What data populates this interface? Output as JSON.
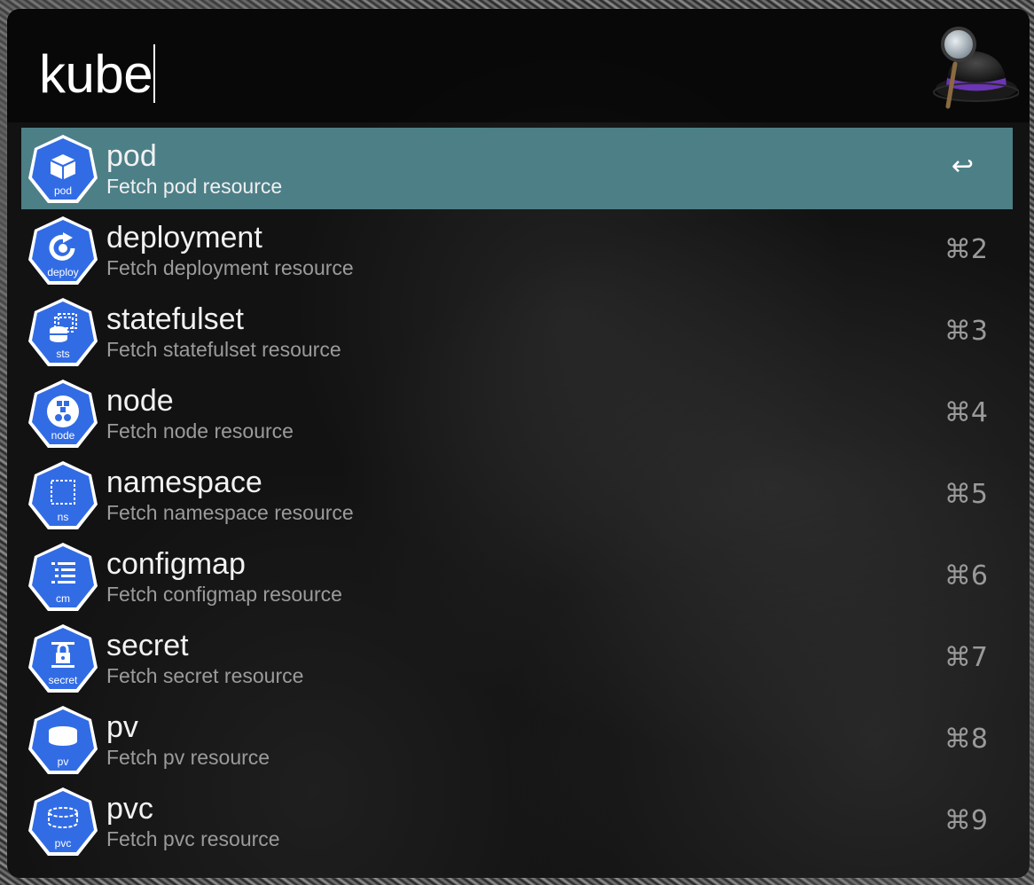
{
  "search": {
    "query": "kube"
  },
  "app": {
    "logo_icon": "alfred-hat-icon"
  },
  "colors": {
    "selected_row": "#4d7f87",
    "k8s_blue": "#326ce5"
  },
  "results": [
    {
      "title": "pod",
      "subtitle": "Fetch pod resource",
      "shortcut": "↩",
      "icon_label": "pod",
      "icon": "pod-icon"
    },
    {
      "title": "deployment",
      "subtitle": "Fetch deployment resource",
      "shortcut": "⌘2",
      "icon_label": "deploy",
      "icon": "deployment-icon"
    },
    {
      "title": "statefulset",
      "subtitle": "Fetch statefulset resource",
      "shortcut": "⌘3",
      "icon_label": "sts",
      "icon": "statefulset-icon"
    },
    {
      "title": "node",
      "subtitle": "Fetch node resource",
      "shortcut": "⌘4",
      "icon_label": "node",
      "icon": "node-icon"
    },
    {
      "title": "namespace",
      "subtitle": "Fetch namespace resource",
      "shortcut": "⌘5",
      "icon_label": "ns",
      "icon": "namespace-icon"
    },
    {
      "title": "configmap",
      "subtitle": "Fetch configmap resource",
      "shortcut": "⌘6",
      "icon_label": "cm",
      "icon": "configmap-icon"
    },
    {
      "title": "secret",
      "subtitle": "Fetch secret resource",
      "shortcut": "⌘7",
      "icon_label": "secret",
      "icon": "secret-icon"
    },
    {
      "title": "pv",
      "subtitle": "Fetch pv resource",
      "shortcut": "⌘8",
      "icon_label": "pv",
      "icon": "pv-icon"
    },
    {
      "title": "pvc",
      "subtitle": "Fetch pvc resource",
      "shortcut": "⌘9",
      "icon_label": "pvc",
      "icon": "pvc-icon"
    }
  ]
}
